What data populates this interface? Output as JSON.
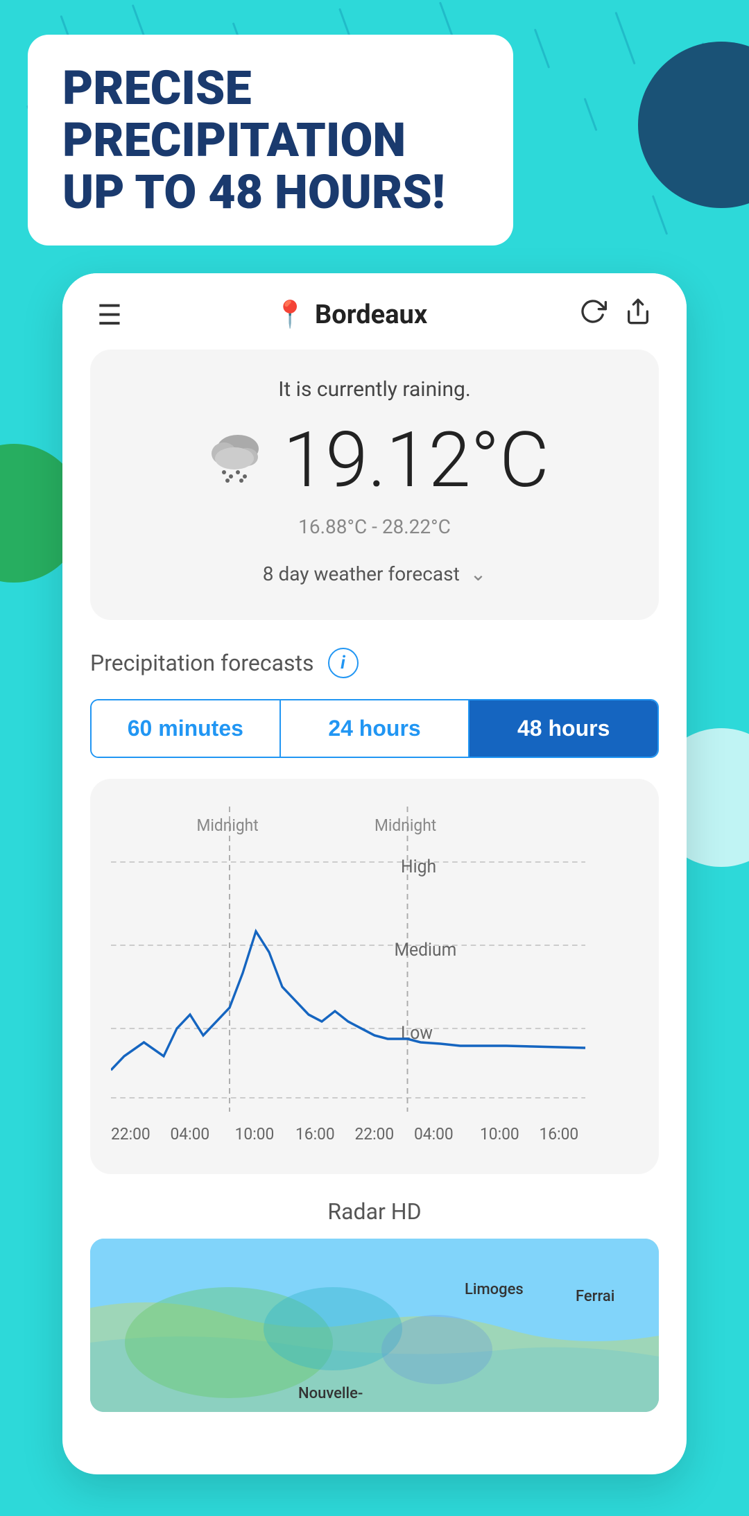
{
  "background": {
    "color": "#2dd9d9"
  },
  "headline": {
    "text": "PRECISE PRECIPITATION UP TO 48 HOURS!"
  },
  "app": {
    "city": "Bordeaux",
    "menu_icon": "☰",
    "location_pin": "📍",
    "refresh_label": "refresh",
    "share_label": "share"
  },
  "weather": {
    "status": "It is currently raining.",
    "temperature": "19.12°C",
    "temp_range": "16.88°C - 28.22°C",
    "forecast_label": "8 day weather forecast"
  },
  "precipitation": {
    "title": "Precipitation forecasts",
    "tabs": [
      {
        "label": "60 minutes",
        "active": false
      },
      {
        "label": "24 hours",
        "active": false
      },
      {
        "label": "48 hours",
        "active": true
      }
    ],
    "chart": {
      "y_labels": [
        "High",
        "Medium",
        "Low"
      ],
      "x_labels": [
        "22:00",
        "04:00",
        "10:00",
        "16:00",
        "22:00",
        "04:00",
        "10:00",
        "16:00"
      ],
      "midnight_labels": [
        "Midnight",
        "Midnight"
      ]
    }
  },
  "radar": {
    "title": "Radar HD",
    "map_labels": [
      "Limoges",
      "Ferrai",
      "Nouvelle-"
    ]
  }
}
